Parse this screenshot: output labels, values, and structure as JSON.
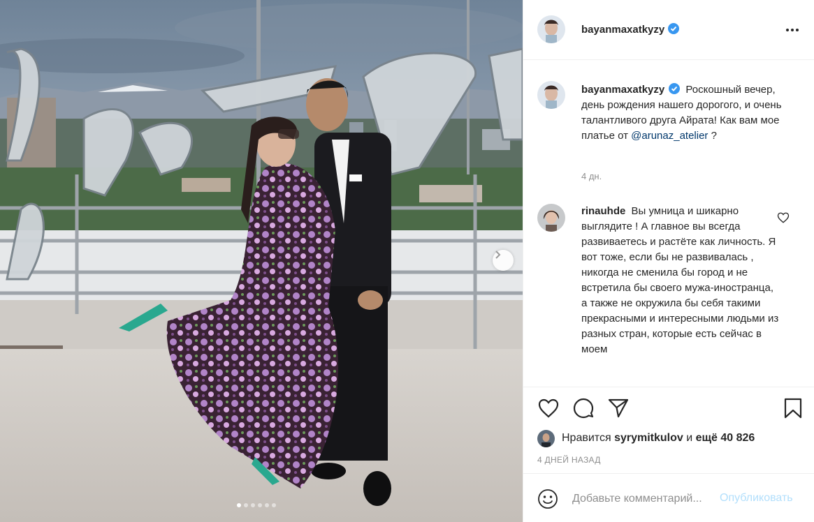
{
  "post": {
    "username": "bayanmaxatkyzy",
    "more_icon": "more-horizontal-icon",
    "caption": "Роскошный вечер, день рождения нашего дорогого, и очень талантливого друга Айрата! Как вам мое платье от",
    "caption_mention": "@arunaz_atelier",
    "caption_end": " ?",
    "caption_time": "4 дн.",
    "image_alt": "Photo: woman in floral dress and man in black suit on rooftop"
  },
  "comment": {
    "username": "rinauhde",
    "text": "Вы умница и шикарно выглядите ! А главное вы всегда развиваетесь и растёте как личность. Я вот тоже, если бы не развивалась , никогда не сменила бы город и не встретила бы своего мужа-иностранца, а также не окружила бы себя такими прекрасными и интересными людьми из разных стран, которые есть сейчас в моем"
  },
  "likes": {
    "prefix": "Нравится",
    "user": "syrymitkulov",
    "middle": "и",
    "count": "ещё 40 826"
  },
  "time_ago": "4 ДНЕЙ НАЗАД",
  "add_comment": {
    "placeholder": "Добавьте комментарий...",
    "post_label": "Опубликовать"
  },
  "carousel": {
    "total": 6,
    "active": 1
  },
  "colors": {
    "verified": "#3897f0",
    "link": "#00376b",
    "post_disabled": "#b2dffc",
    "muted": "#8e8e8e"
  }
}
